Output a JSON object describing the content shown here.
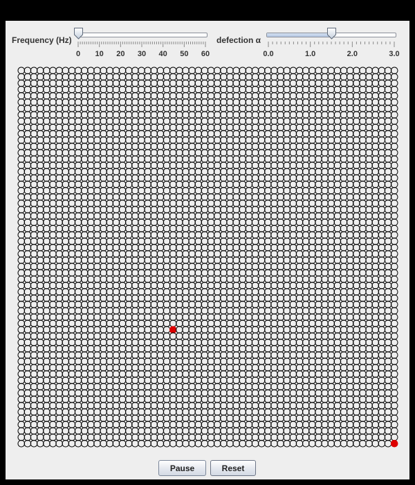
{
  "frequency": {
    "label": "Frequency (Hz)",
    "value": 0,
    "min": 0,
    "max": 60,
    "major_ticks": [
      "0",
      "10",
      "20",
      "30",
      "40",
      "50",
      "60"
    ]
  },
  "deflection": {
    "label": "defection α",
    "value": 1.5,
    "min": 0,
    "max": 3,
    "major_ticks": [
      "0.0",
      "1.0",
      "2.0",
      "3.0"
    ]
  },
  "lattice": {
    "columns": 60,
    "rows": 60,
    "highlighted": [
      {
        "col": 24,
        "row": 41
      },
      {
        "col": 59,
        "row": 59
      }
    ],
    "ring_color": "#000000",
    "highlight_color": "#dd0000"
  },
  "buttons": {
    "pause_label": "Pause",
    "reset_label": "Reset"
  }
}
